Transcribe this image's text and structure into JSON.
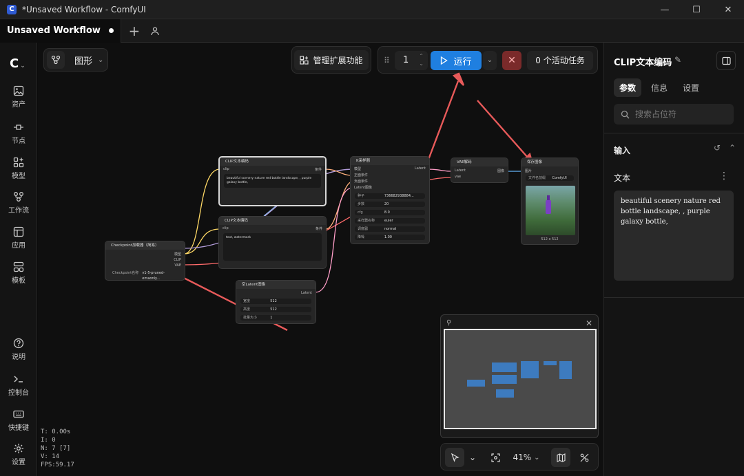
{
  "window": {
    "title": "*Unsaved Workflow - ComfyUI",
    "app_icon": "C"
  },
  "tabs": [
    {
      "label": "Unsaved Workflow"
    }
  ],
  "sidebar": {
    "items": [
      {
        "label": "资产"
      },
      {
        "label": "节点"
      },
      {
        "label": "模型"
      },
      {
        "label": "工作流"
      },
      {
        "label": "应用"
      },
      {
        "label": "模板"
      },
      {
        "label": "说明"
      },
      {
        "label": "控制台"
      },
      {
        "label": "快捷键"
      },
      {
        "label": "设置"
      }
    ]
  },
  "toolbar": {
    "view_label": "图形",
    "extensions_label": "管理扩展功能",
    "batch_count": "1",
    "run_label": "运行",
    "tasks_label": "0 个活动任务"
  },
  "nodes": {
    "clip_pos": {
      "title": "CLIP文本编码",
      "in_label": "clip",
      "out_label": "条件",
      "text": "beautiful scenery nature red bottle landscape, , purple galaxy bottle,"
    },
    "clip_neg": {
      "title": "CLIP文本编码",
      "in_label": "clip",
      "out_label": "条件",
      "text": "text, watermark"
    },
    "checkpoint": {
      "title": "Checkpoint加载器（简易）",
      "out_model": "模型",
      "out_clip": "CLIP",
      "out_vae": "VAE",
      "widget_label": "Checkpoint名称",
      "widget_value": "v1-5-pruned-emaonly..."
    },
    "ksampler": {
      "title": "K采样器",
      "inputs": [
        "模型",
        "正面条件",
        "负面条件",
        "Latent图像"
      ],
      "out_label": "Latent",
      "widgets": [
        {
          "label": "种子",
          "value": "736682938884..."
        },
        {
          "label": "步数",
          "value": "20"
        },
        {
          "label": "cfg",
          "value": "8.0"
        },
        {
          "label": "采样器名称",
          "value": "euler"
        },
        {
          "label": "调度器",
          "value": "normal"
        },
        {
          "label": "降噪",
          "value": "1.00"
        }
      ]
    },
    "vae_decode": {
      "title": "VAE解码",
      "in_latent": "Latent",
      "in_vae": "vae",
      "out_label": "图像"
    },
    "save_image": {
      "title": "保存图像",
      "in_label": "图片",
      "widget_label": "文件名前缀",
      "widget_value": "ComfyUI",
      "caption": "512 x 512"
    },
    "empty_latent": {
      "title": "空Latent图像",
      "out_label": "Latent",
      "widgets": [
        {
          "label": "宽度",
          "value": "512"
        },
        {
          "label": "高度",
          "value": "512"
        },
        {
          "label": "批量大小",
          "value": "1"
        }
      ]
    }
  },
  "stats": {
    "t": "T: 0.00s",
    "i": "I: 0",
    "n": "N: 7 [7]",
    "v": "V: 14",
    "fps": "FPS:59.17"
  },
  "bottom_toolbar": {
    "zoom": "41%"
  },
  "right_panel": {
    "title": "CLIP文本编码",
    "tabs": [
      {
        "label": "参数"
      },
      {
        "label": "信息"
      },
      {
        "label": "设置"
      }
    ],
    "search_placeholder": "搜索占位符",
    "section_title": "输入",
    "field_label": "文本",
    "field_value": "beautiful scenery nature red bottle landscape, , purple galaxy bottle,"
  },
  "colors": {
    "accent": "#1f7fe0",
    "annotation_arrow": "#e85a5a",
    "cancel": "#7a2a2a"
  }
}
